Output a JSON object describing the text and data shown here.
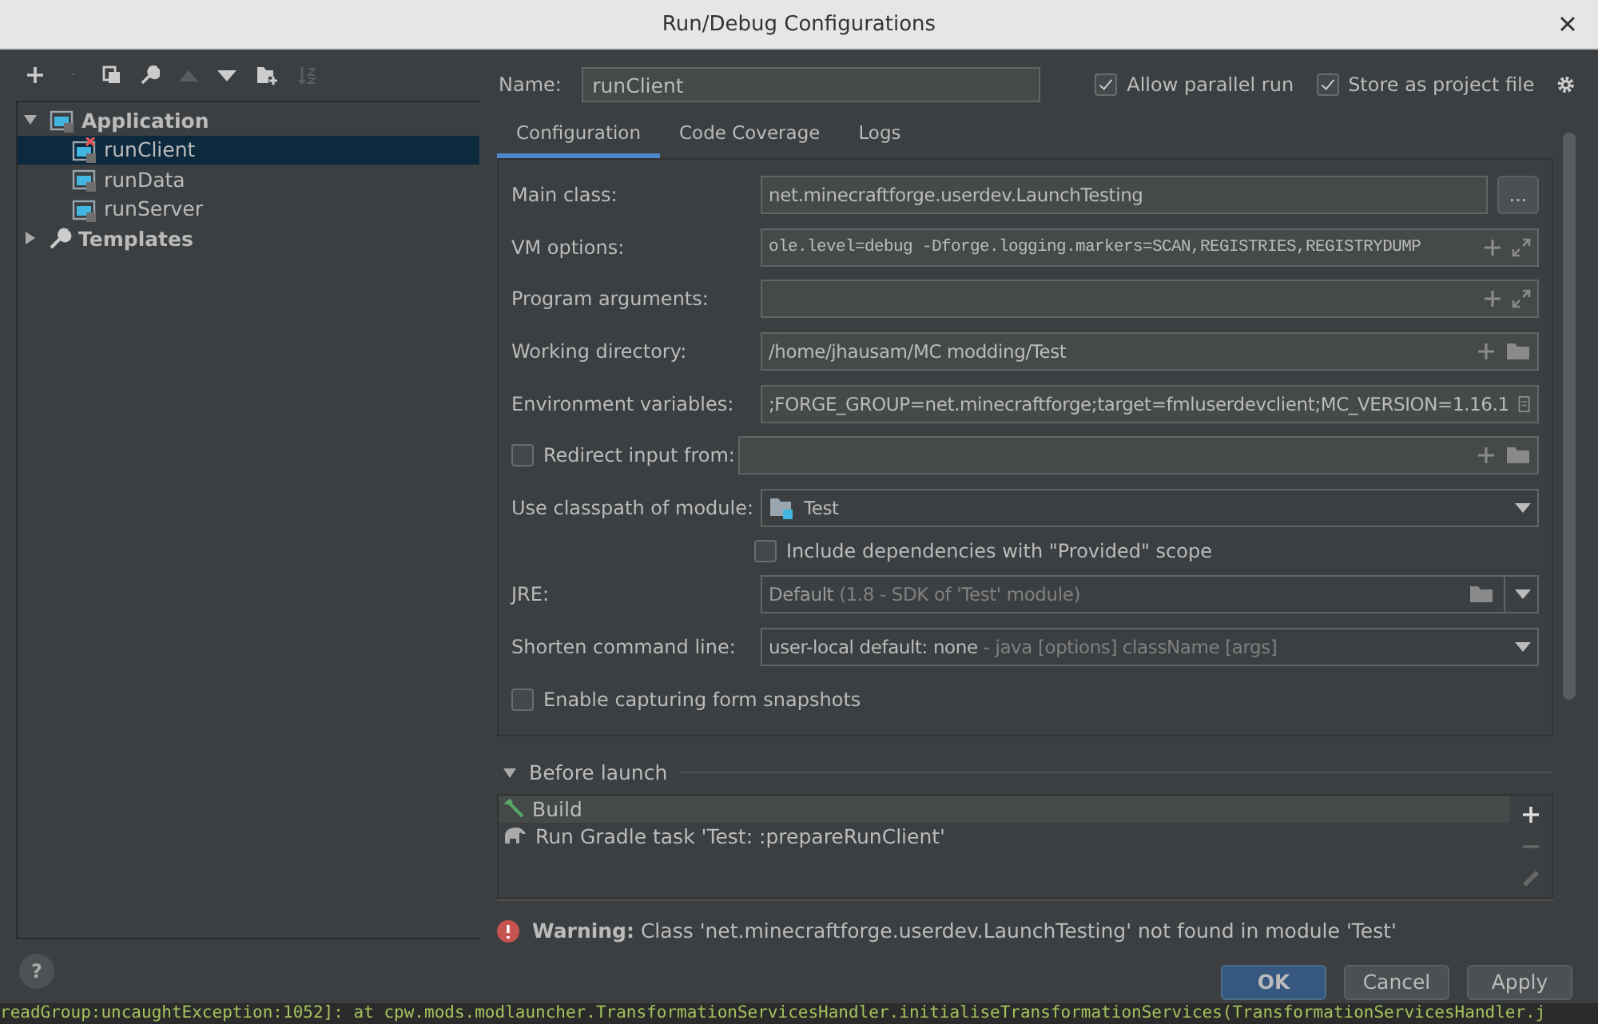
{
  "window": {
    "title": "Run/Debug Configurations"
  },
  "tree": [
    {
      "label": "Application",
      "expanded": true,
      "selected": false,
      "children": [
        {
          "label": "runClient",
          "selected": true,
          "has_error": true
        },
        {
          "label": "runData",
          "selected": false,
          "has_error": false
        },
        {
          "label": "runServer",
          "selected": false,
          "has_error": false
        }
      ]
    },
    {
      "label": "Templates",
      "expanded": false,
      "selected": false
    }
  ],
  "name": {
    "label": "Name:",
    "value": "runClient"
  },
  "options": [
    {
      "label": "Allow parallel run",
      "checked": true
    },
    {
      "label": "Store as project file",
      "checked": true
    }
  ],
  "tabs": [
    {
      "label": "Configuration",
      "selected": true
    },
    {
      "label": "Code Coverage",
      "selected": false
    },
    {
      "label": "Logs",
      "selected": false
    }
  ],
  "fields": [
    {
      "kind": "browse",
      "label": "Main class:",
      "value": "net.minecraftforge.userdev.LaunchTesting",
      "button": "..."
    },
    {
      "kind": "code",
      "label": "VM options:",
      "value": "ole.level=debug -Dforge.logging.markers=SCAN,REGISTRIES,REGISTRYDUMP"
    },
    {
      "kind": "expandable",
      "label": "Program arguments:"
    },
    {
      "kind": "folder",
      "label": "Working directory:",
      "value": "/home/jhausam/MC modding/Test"
    },
    {
      "kind": "env",
      "label": "Environment variables:",
      "value": ";FORGE_GROUP=net.minecraftforge;target=fmluserdevclient;MC_VERSION=1.16.1"
    },
    {
      "kind": "redirect",
      "label": "Redirect input from:",
      "checked": false
    },
    {
      "kind": "module",
      "label": "Use classpath of module:",
      "value": "Test"
    },
    {
      "kind": "checkbox",
      "label": "Include dependencies with \"Provided\" scope",
      "checked": false
    },
    {
      "kind": "jre",
      "label": "JRE:",
      "value": "Default",
      "hint": "(1.8 - SDK of 'Test' module)"
    },
    {
      "kind": "combo",
      "label": "Shorten command line:",
      "value": "user-local default: none",
      "hint": "- java [options] className [args]"
    },
    {
      "kind": "option",
      "label": "Enable capturing form snapshots",
      "checked": false
    }
  ],
  "before_launch": {
    "title": "Before launch",
    "expanded": true,
    "tasks": [
      {
        "kind": "build",
        "label": "Build",
        "selected": true
      },
      {
        "kind": "gradle",
        "label": "Run Gradle task 'Test: :prepareRunClient'",
        "selected": false
      }
    ]
  },
  "warning": {
    "label": "Warning:",
    "message": "Class 'net.minecraftforge.userdev.LaunchTesting' not found in module 'Test'"
  },
  "help": "?",
  "buttons": [
    {
      "label": "OK",
      "default": true
    },
    {
      "label": "Cancel",
      "default": false
    },
    {
      "label": "Apply",
      "default": false
    }
  ],
  "console_line": "readGroup:uncaughtException:1052]:   at cpw.mods.modlauncher.TransformationServicesHandler.initialiseTransformationServices(TransformationServicesHandler.j"
}
